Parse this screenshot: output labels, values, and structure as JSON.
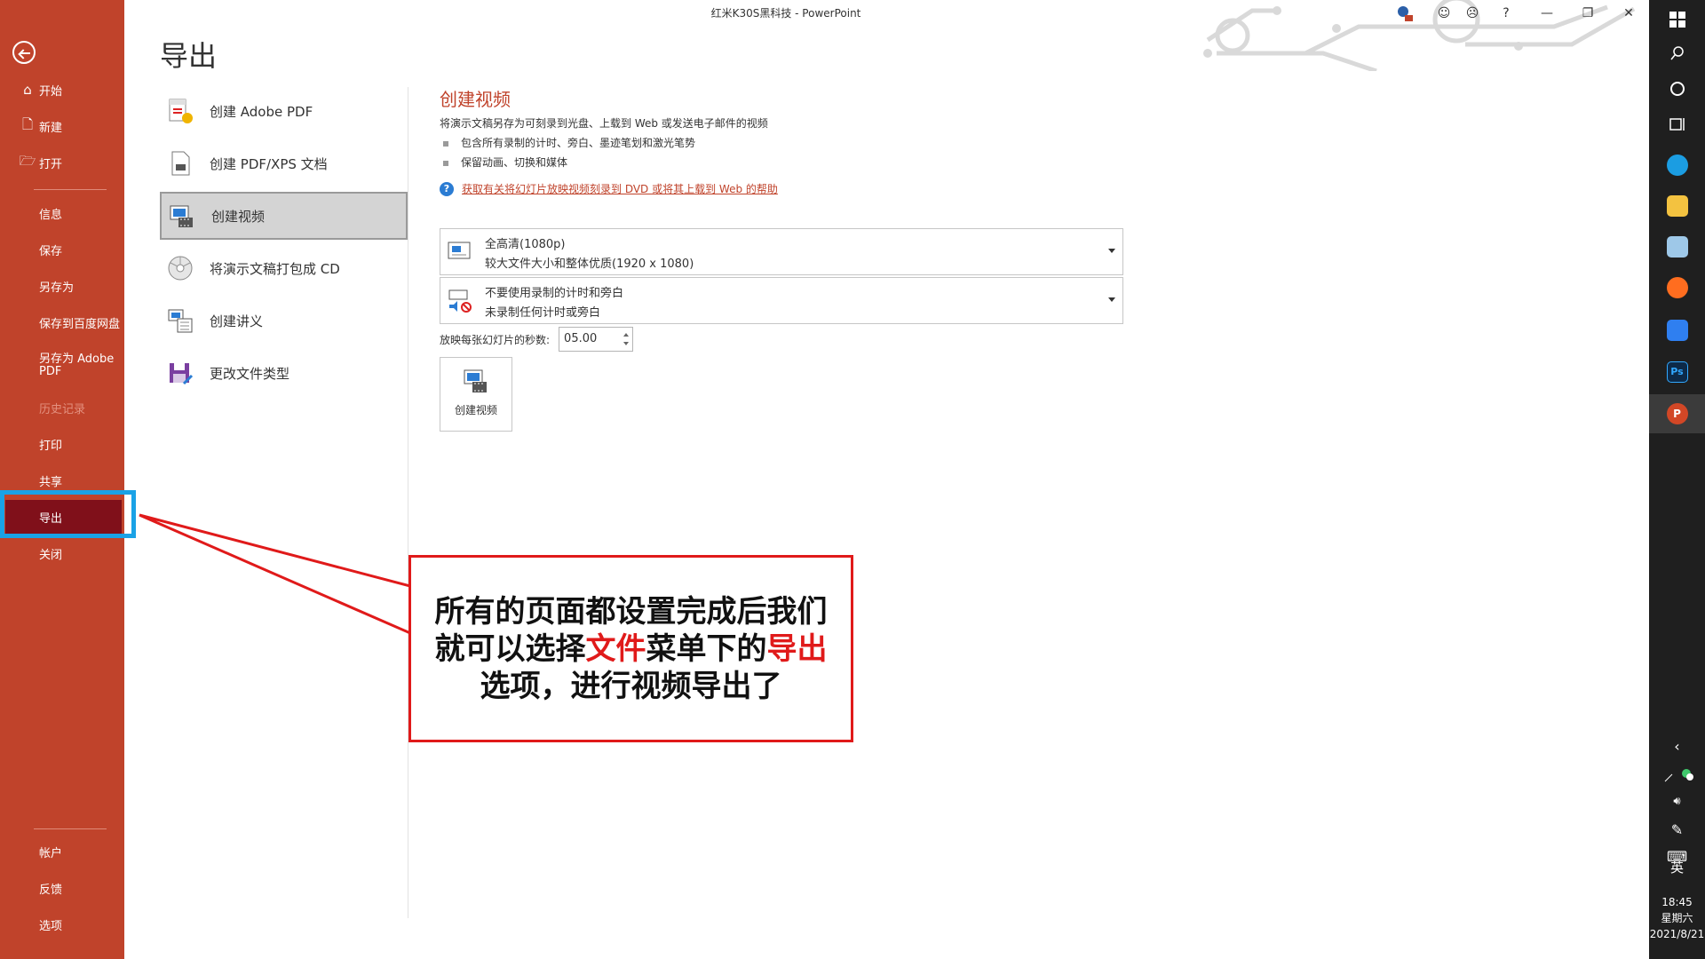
{
  "window": {
    "title": "红米K30S黑科技  -  PowerPoint"
  },
  "sidebar": {
    "items": [
      {
        "label": "开始",
        "icon": "home-icon"
      },
      {
        "label": "新建",
        "icon": "new-document-icon"
      },
      {
        "label": "打开",
        "icon": "folder-open-icon"
      },
      {
        "label": "信息"
      },
      {
        "label": "保存"
      },
      {
        "label": "另存为"
      },
      {
        "label": "保存到百度网盘"
      },
      {
        "label": "另存为 Adobe PDF"
      },
      {
        "label": "历史记录"
      },
      {
        "label": "打印"
      },
      {
        "label": "共享"
      },
      {
        "label": "导出"
      },
      {
        "label": "关闭"
      },
      {
        "label": "帐户"
      },
      {
        "label": "反馈"
      },
      {
        "label": "选项"
      }
    ],
    "active_item": "导出"
  },
  "main": {
    "page_title": "导出",
    "export_options": [
      {
        "label": "创建 Adobe PDF"
      },
      {
        "label": "创建 PDF/XPS 文档"
      },
      {
        "label": "创建视频"
      },
      {
        "label": "将演示文稿打包成 CD"
      },
      {
        "label": "创建讲义"
      },
      {
        "label": "更改文件类型"
      }
    ],
    "selected_option": "创建视频"
  },
  "detail": {
    "title": "创建视频",
    "description": "将演示文稿另存为可刻录到光盘、上载到 Web 或发送电子邮件的视频",
    "bullets": [
      "包含所有录制的计时、旁白、墨迹笔划和激光笔势",
      "保留动画、切换和媒体"
    ],
    "help_link": "获取有关将幻灯片放映视频刻录到 DVD 或将其上载到 Web 的帮助",
    "quality_dropdown": {
      "title": "全高清(1080p)",
      "subtitle": "较大文件大小和整体优质(1920 x 1080)"
    },
    "timing_dropdown": {
      "title": "不要使用录制的计时和旁白",
      "subtitle": "未录制任何计时或旁白"
    },
    "seconds_label": "放映每张幻灯片的秒数:",
    "seconds_value": "05.00",
    "create_button_label": "创建视频"
  },
  "annotation": {
    "line1": "所有的页面都设置完成后我们",
    "line2_pre": "就可以选择",
    "line2_hl1": "文件",
    "line2_mid": "菜单下的",
    "line2_hl2": "导出",
    "line3": "选项，进行视频导出了"
  },
  "titlebar": {
    "help": "?",
    "minimize": "—",
    "restore": "❐",
    "close": "✕"
  },
  "taskbar": {
    "lang": "英",
    "time": "18:45",
    "weekday": "星期六",
    "date": "2021/8/21"
  },
  "colors": {
    "sidebar": "#c0432b",
    "active": "#80101a",
    "highlight_box": "#1aa2e6",
    "annotation": "#e01a1a"
  }
}
